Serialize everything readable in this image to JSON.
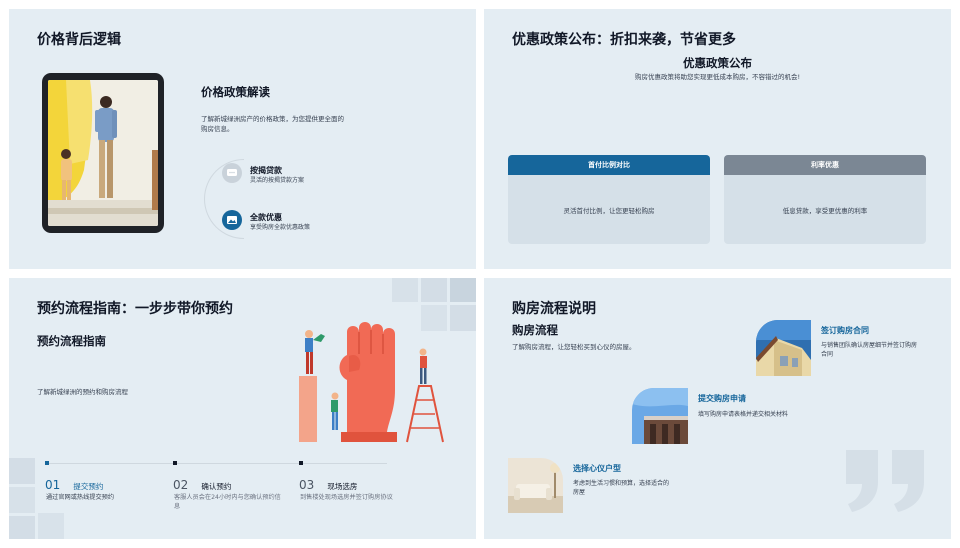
{
  "slide1": {
    "title": "价格背后逻辑",
    "heading": "价格政策解读",
    "desc_line1": "了解新城绿洲房产的价格政策，为您提供更全面的",
    "desc_line2": "购房信息。",
    "item1_title": "按揭贷款",
    "item1_desc": "灵活的按揭贷款方案",
    "item2_title": "全款优惠",
    "item2_desc": "享受购房全款优惠政策"
  },
  "slide2": {
    "title": "优惠政策公布：折扣来袭，节省更多",
    "subtitle": "优惠政策公布",
    "desc": "购房优惠政策将助您实现更低成本购房，不容错过的机会!",
    "card1_title": "首付比例对比",
    "card1_desc": "灵活首付比例，让您更轻松购房",
    "card2_title": "利率优惠",
    "card2_desc": "低息贷款，享受更优惠的利率",
    "colors": {
      "card1_head": "#16669b",
      "card2_head": "#7b8794"
    }
  },
  "slide3": {
    "title": "预约流程指南：一步步带你预约",
    "heading": "预约流程指南",
    "desc": "了解新城绿洲的预约和购房流程",
    "steps": [
      {
        "num": "01",
        "title": "提交预约",
        "desc1": "通过官网或热线提交预约",
        "desc2": ""
      },
      {
        "num": "02",
        "title": "确认预约",
        "desc1": "客服人员会在24小时内与您确认预约信",
        "desc2": "息"
      },
      {
        "num": "03",
        "title": "现场选房",
        "desc1": "到售楼处现场选房并签订购房协议",
        "desc2": ""
      }
    ],
    "colors": {
      "accent": "#16669b"
    }
  },
  "slide4": {
    "title": "购房流程说明",
    "heading": "购房流程",
    "desc": "了解购房流程，让您轻松买到心仪的房屋。",
    "items": [
      {
        "title": "签订购房合同",
        "desc1": "与销售团队确认房屋细节并签订购房",
        "desc2": "合同"
      },
      {
        "title": "提交购房申请",
        "desc1": "填写购房申请表格并递交相关材料",
        "desc2": ""
      },
      {
        "title": "选择心仪户型",
        "desc1": "考虑到生活习惯和预算，选择适合的",
        "desc2": "房屋"
      }
    ],
    "colors": {
      "accent": "#16669b"
    }
  }
}
